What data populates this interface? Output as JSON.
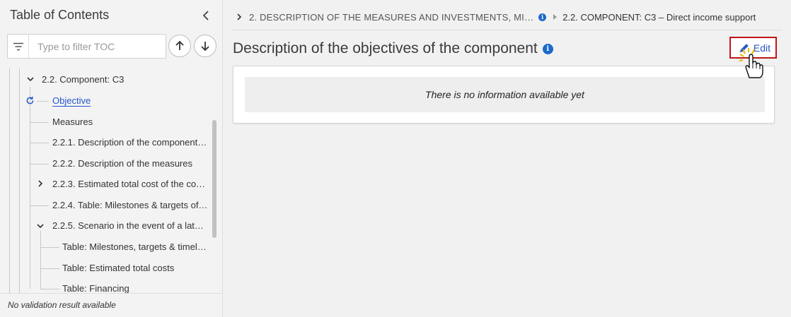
{
  "sidebar": {
    "title": "Table of Contents",
    "filter_placeholder": "Type to filter TOC",
    "footer_text": "No validation result available",
    "tree": {
      "component": "2.2. Component: C3",
      "objective": "Objective",
      "measures": "Measures",
      "item_221": "2.2.1. Description of the component…",
      "item_222": "2.2.2. Description of the measures",
      "item_223": "2.2.3. Estimated total cost of the co…",
      "item_224": "2.2.4. Table: Milestones & targets of…",
      "item_225": "2.2.5. Scenario in the event of a late…",
      "sub_milestones": "Table: Milestones, targets & timeli…",
      "sub_costs": "Table: Estimated total costs",
      "sub_financing": "Table: Financing"
    }
  },
  "main": {
    "breadcrumb": {
      "first": "2. DESCRIPTION OF THE MEASURES AND INVESTMENTS, MI…",
      "last": "2.2. COMPONENT: C3 – Direct income support"
    },
    "title": "Description of the objectives of the component",
    "edit_label": "Edit",
    "empty_message": "There is no information available yet"
  },
  "icons": {
    "info": "i"
  },
  "colors": {
    "link_blue": "#2556c9",
    "info_blue": "#1b6ac9",
    "highlight_red": "#c0161a"
  }
}
